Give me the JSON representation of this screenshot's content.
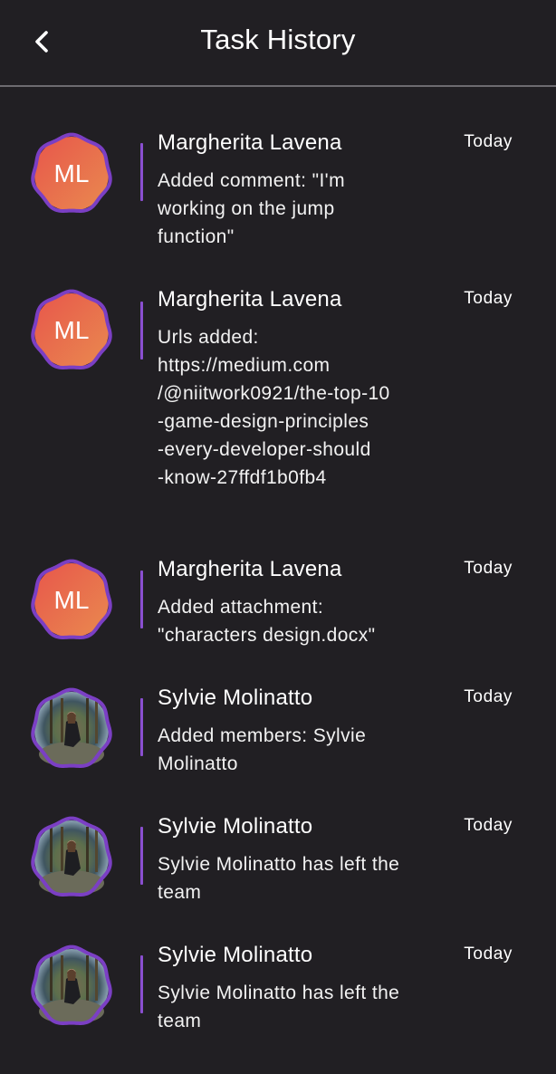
{
  "header": {
    "title": "Task History",
    "back_icon": "chevron-left-icon"
  },
  "colors": {
    "background": "#211f23",
    "accent_purple": "#8a4fd0",
    "avatar_gradient_start": "#e8564b",
    "avatar_gradient_end": "#e98a4f",
    "avatar_ring": "#7b3fc4"
  },
  "entries": [
    {
      "author": "Margherita Lavena",
      "initials": "ML",
      "avatar": "initials",
      "time": "Today",
      "message": "Added comment: \"I'm\nworking on the jump\nfunction\""
    },
    {
      "author": "Margherita Lavena",
      "initials": "ML",
      "avatar": "initials",
      "time": "Today",
      "message": "Urls added:\nhttps://medium.com\n/@niitwork0921/the-top-10\n-game-design-principles\n-every-developer-should\n-know-27ffdf1b0fb4"
    },
    {
      "author": "Margherita Lavena",
      "initials": "ML",
      "avatar": "initials",
      "time": "Today",
      "message": "Added attachment:\n\"characters design.docx\""
    },
    {
      "author": "Sylvie Molinatto",
      "initials": "",
      "avatar": "photo",
      "time": "Today",
      "message": "Added members: Sylvie\nMolinatto"
    },
    {
      "author": "Sylvie Molinatto",
      "initials": "",
      "avatar": "photo",
      "time": "Today",
      "message": "Sylvie Molinatto has left the\nteam"
    },
    {
      "author": "Sylvie Molinatto",
      "initials": "",
      "avatar": "photo",
      "time": "Today",
      "message": "Sylvie Molinatto has left the\nteam"
    }
  ]
}
